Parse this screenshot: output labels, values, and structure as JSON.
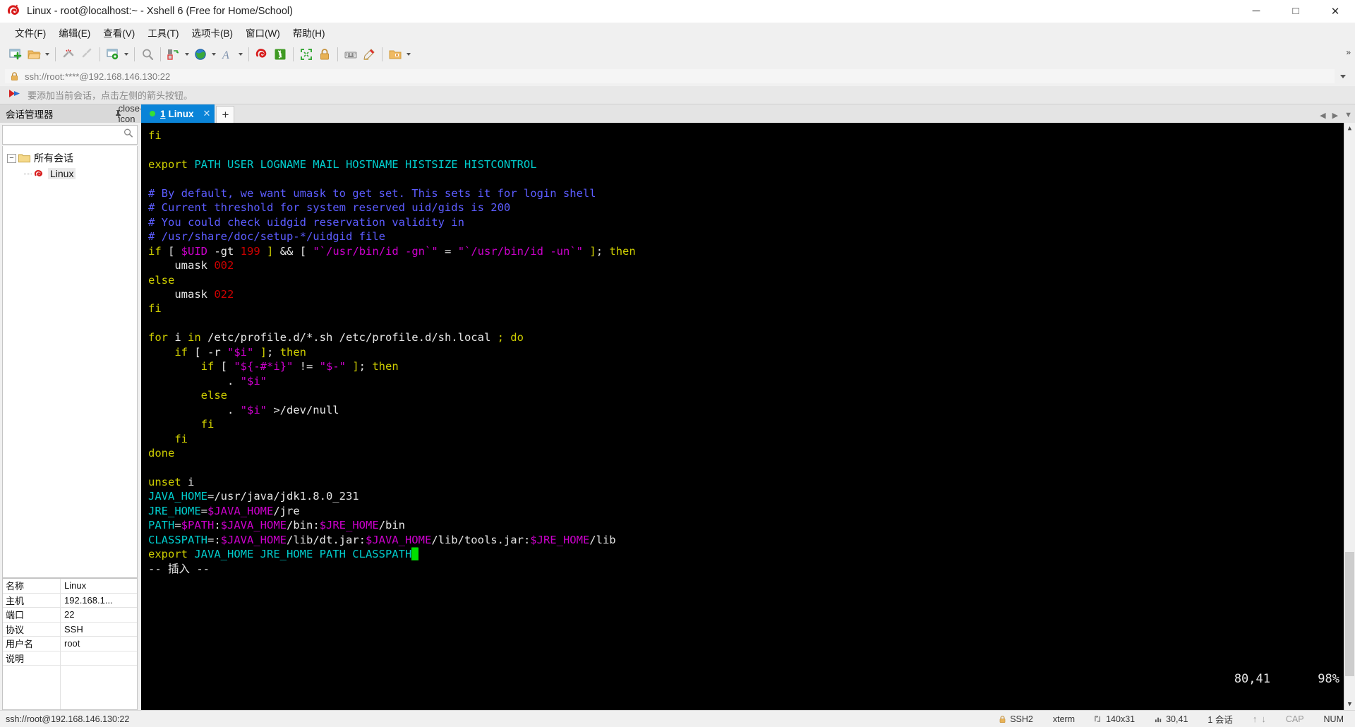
{
  "window": {
    "title": "Linux - root@localhost:~ - Xshell 6 (Free for Home/School)",
    "app_icon": "xshell-logo-icon",
    "minimize": "─",
    "maximize": "□",
    "close": "✕"
  },
  "menubar": {
    "items": [
      {
        "label": "文件(F)",
        "name": "menu-file"
      },
      {
        "label": "编辑(E)",
        "name": "menu-edit"
      },
      {
        "label": "查看(V)",
        "name": "menu-view"
      },
      {
        "label": "工具(T)",
        "name": "menu-tools"
      },
      {
        "label": "选项卡(B)",
        "name": "menu-tabs"
      },
      {
        "label": "窗口(W)",
        "name": "menu-window"
      },
      {
        "label": "帮助(H)",
        "name": "menu-help"
      }
    ]
  },
  "toolbar": {
    "overflow": "»",
    "icons": [
      "new-session-icon",
      "open-folder-icon",
      "folder-dropdown-caret",
      "disconnect-icon",
      "reconnect-icon",
      "session-properties-icon",
      "properties-dropdown-caret",
      "find-icon",
      "transfer-file-icon",
      "transfer-dropdown-caret",
      "globe-icon",
      "globe-dropdown-caret",
      "font-icon",
      "font-dropdown-caret",
      "xshell-icon",
      "xftp-icon",
      "fullscreen-icon",
      "lock-icon",
      "keyboard-icon",
      "highlight-icon",
      "compose-icon",
      "compose-dropdown-caret"
    ]
  },
  "address": {
    "value": "ssh://root:****@192.168.146.130:22",
    "lock_icon": "lock-icon",
    "caret": "chevron-down-icon"
  },
  "hint": {
    "icon": "arrow-hint-icon",
    "text": "要添加当前会话，点击左侧的箭头按钮。"
  },
  "sidebar": {
    "title": "会话管理器",
    "pin_icon": "pin-icon",
    "close_icon": "close-icon",
    "search": {
      "value": "",
      "placeholder": "",
      "icon": "search-icon"
    },
    "tree": [
      {
        "label": "所有会话",
        "icon": "folder-icon",
        "expander": "−",
        "level": 1,
        "selected": false
      },
      {
        "label": "Linux",
        "icon": "session-icon",
        "level": 2,
        "selected": true
      }
    ],
    "properties": [
      {
        "key": "名称",
        "value": "Linux"
      },
      {
        "key": "主机",
        "value": "192.168.1..."
      },
      {
        "key": "端口",
        "value": "22"
      },
      {
        "key": "协议",
        "value": "SSH"
      },
      {
        "key": "用户名",
        "value": "root"
      },
      {
        "key": "说明",
        "value": ""
      }
    ]
  },
  "tabbar": {
    "tabs": [
      {
        "num": "1",
        "label": "Linux",
        "status_dot": "#35e035",
        "close": "✕",
        "active": true
      }
    ],
    "new_tab": "+",
    "nav_prev": "◀",
    "nav_next": "▶",
    "nav_menu": "▼"
  },
  "terminal": {
    "position": "80,41",
    "percent": "98%",
    "cursor_color": "#00e000",
    "lines": [
      [
        {
          "t": "fi",
          "c": "yellow"
        }
      ],
      [],
      [
        {
          "t": "export",
          "c": "yellow"
        },
        {
          "t": " PATH USER LOGNAME MAIL HOSTNAME HISTSIZE HISTCONTROL",
          "c": "cyan"
        }
      ],
      [],
      [
        {
          "t": "# By default, we want umask to get set. This sets it for login shell",
          "c": "blue"
        }
      ],
      [
        {
          "t": "# Current threshold for system reserved uid/gids is 200",
          "c": "blue"
        }
      ],
      [
        {
          "t": "# You could check uidgid reservation validity in",
          "c": "blue"
        }
      ],
      [
        {
          "t": "# /usr/share/doc/setup-*/uidgid file",
          "c": "blue"
        }
      ],
      [
        {
          "t": "if",
          "c": "yellow"
        },
        {
          "t": " [ ",
          "c": "white"
        },
        {
          "t": "$UID",
          "c": "mag"
        },
        {
          "t": " -gt ",
          "c": "white"
        },
        {
          "t": "199",
          "c": "red"
        },
        {
          "t": " ",
          "c": "white"
        },
        {
          "t": "]",
          "c": "yellow"
        },
        {
          "t": " ",
          "c": "white"
        },
        {
          "t": "&&",
          "c": "white"
        },
        {
          "t": " [ ",
          "c": "white"
        },
        {
          "t": "\"`/usr/bin/id -gn`\"",
          "c": "mag"
        },
        {
          "t": " = ",
          "c": "white"
        },
        {
          "t": "\"`/usr/bin/id -un`\"",
          "c": "mag"
        },
        {
          "t": " ",
          "c": "white"
        },
        {
          "t": "]",
          "c": "yellow"
        },
        {
          "t": "; ",
          "c": "white"
        },
        {
          "t": "then",
          "c": "yellow"
        }
      ],
      [
        {
          "t": "    umask ",
          "c": "white"
        },
        {
          "t": "002",
          "c": "red"
        }
      ],
      [
        {
          "t": "else",
          "c": "yellow"
        }
      ],
      [
        {
          "t": "    umask ",
          "c": "white"
        },
        {
          "t": "022",
          "c": "red"
        }
      ],
      [
        {
          "t": "fi",
          "c": "yellow"
        }
      ],
      [],
      [
        {
          "t": "for",
          "c": "yellow"
        },
        {
          "t": " i ",
          "c": "white"
        },
        {
          "t": "in",
          "c": "yellow"
        },
        {
          "t": " /etc/profile.d/*.sh /etc/profile.d/sh.local ",
          "c": "white"
        },
        {
          "t": ";",
          "c": "yellow"
        },
        {
          "t": " ",
          "c": "white"
        },
        {
          "t": "do",
          "c": "yellow"
        }
      ],
      [
        {
          "t": "    ",
          "c": "white"
        },
        {
          "t": "if",
          "c": "yellow"
        },
        {
          "t": " [ -r ",
          "c": "white"
        },
        {
          "t": "\"$i\"",
          "c": "mag"
        },
        {
          "t": " ",
          "c": "white"
        },
        {
          "t": "]",
          "c": "yellow"
        },
        {
          "t": "; ",
          "c": "white"
        },
        {
          "t": "then",
          "c": "yellow"
        }
      ],
      [
        {
          "t": "        ",
          "c": "white"
        },
        {
          "t": "if",
          "c": "yellow"
        },
        {
          "t": " [ ",
          "c": "white"
        },
        {
          "t": "\"${-#*i}\"",
          "c": "mag"
        },
        {
          "t": " != ",
          "c": "white"
        },
        {
          "t": "\"$-\"",
          "c": "mag"
        },
        {
          "t": " ",
          "c": "white"
        },
        {
          "t": "]",
          "c": "yellow"
        },
        {
          "t": "; ",
          "c": "white"
        },
        {
          "t": "then",
          "c": "yellow"
        }
      ],
      [
        {
          "t": "            . ",
          "c": "white"
        },
        {
          "t": "\"$i\"",
          "c": "mag"
        }
      ],
      [
        {
          "t": "        ",
          "c": "white"
        },
        {
          "t": "else",
          "c": "yellow"
        }
      ],
      [
        {
          "t": "            . ",
          "c": "white"
        },
        {
          "t": "\"$i\"",
          "c": "mag"
        },
        {
          "t": " >/dev/null",
          "c": "white"
        }
      ],
      [
        {
          "t": "        ",
          "c": "white"
        },
        {
          "t": "fi",
          "c": "yellow"
        }
      ],
      [
        {
          "t": "    ",
          "c": "white"
        },
        {
          "t": "fi",
          "c": "yellow"
        }
      ],
      [
        {
          "t": "done",
          "c": "yellow"
        }
      ],
      [],
      [
        {
          "t": "unset",
          "c": "yellow"
        },
        {
          "t": " i",
          "c": "white"
        }
      ],
      [
        {
          "t": "JAVA_HOME",
          "c": "cyan"
        },
        {
          "t": "=/usr/java/jdk1.8.0_231",
          "c": "white"
        }
      ],
      [
        {
          "t": "JRE_HOME",
          "c": "cyan"
        },
        {
          "t": "=",
          "c": "white"
        },
        {
          "t": "$JAVA_HOME",
          "c": "mag"
        },
        {
          "t": "/jre",
          "c": "white"
        }
      ],
      [
        {
          "t": "PATH",
          "c": "cyan"
        },
        {
          "t": "=",
          "c": "white"
        },
        {
          "t": "$PATH",
          "c": "mag"
        },
        {
          "t": ":",
          "c": "white"
        },
        {
          "t": "$JAVA_HOME",
          "c": "mag"
        },
        {
          "t": "/bin:",
          "c": "white"
        },
        {
          "t": "$JRE_HOME",
          "c": "mag"
        },
        {
          "t": "/bin",
          "c": "white"
        }
      ],
      [
        {
          "t": "CLASSPATH",
          "c": "cyan"
        },
        {
          "t": "=:",
          "c": "white"
        },
        {
          "t": "$JAVA_HOME",
          "c": "mag"
        },
        {
          "t": "/lib/dt.jar:",
          "c": "white"
        },
        {
          "t": "$JAVA_HOME",
          "c": "mag"
        },
        {
          "t": "/lib/tools.jar:",
          "c": "white"
        },
        {
          "t": "$JRE_HOME",
          "c": "mag"
        },
        {
          "t": "/lib",
          "c": "white"
        }
      ],
      [
        {
          "t": "export",
          "c": "yellow"
        },
        {
          "t": " JAVA_HOME JRE_HOME PATH CLASSPATH",
          "c": "cyan"
        },
        {
          "t": "█",
          "c": "cursor"
        }
      ],
      [
        {
          "t": "-- 插入 --",
          "c": "white"
        }
      ]
    ]
  },
  "statusbar": {
    "connection": "ssh://root@192.168.146.130:22",
    "cells": [
      {
        "name": "status-protocol",
        "icon": "lock-icon",
        "text": "SSH2",
        "dim": false
      },
      {
        "name": "status-terminal-type",
        "icon": "",
        "text": "xterm",
        "dim": false
      },
      {
        "name": "status-size",
        "icon": "size-icon",
        "text": "140x31",
        "dim": false
      },
      {
        "name": "status-cursor",
        "icon": "cursor-icon",
        "text": "30,41",
        "dim": false
      },
      {
        "name": "status-sessions",
        "icon": "",
        "text": "1 会话",
        "dim": false
      },
      {
        "name": "status-transfer",
        "icon": "updown-arrows-icon",
        "text": "",
        "dim": true
      },
      {
        "name": "status-caps",
        "icon": "",
        "text": "CAP",
        "dim": true
      },
      {
        "name": "status-num",
        "icon": "",
        "text": "NUM",
        "dim": false
      }
    ]
  }
}
